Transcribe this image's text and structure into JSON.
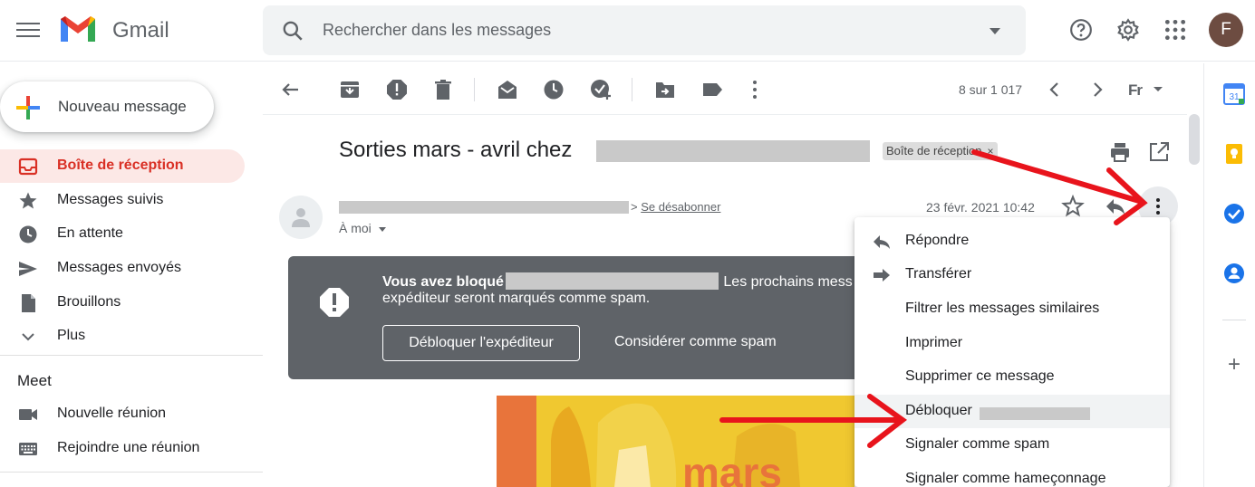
{
  "app": {
    "brand": "Gmail"
  },
  "search": {
    "placeholder": "Rechercher dans les messages"
  },
  "user": {
    "initial": "F",
    "avatar_color": "#6d4c41"
  },
  "compose": {
    "label": "Nouveau message"
  },
  "sidebar": {
    "items": [
      {
        "label": "Boîte de réception",
        "icon": "inbox-icon",
        "active": true
      },
      {
        "label": "Messages suivis",
        "icon": "star-icon"
      },
      {
        "label": "En attente",
        "icon": "clock-icon"
      },
      {
        "label": "Messages envoyés",
        "icon": "send-icon"
      },
      {
        "label": "Brouillons",
        "icon": "draft-icon"
      },
      {
        "label": "Plus",
        "icon": "chevron-down-icon"
      }
    ],
    "meet": {
      "title": "Meet",
      "items": [
        {
          "label": "Nouvelle réunion",
          "icon": "video-icon"
        },
        {
          "label": "Rejoindre une réunion",
          "icon": "keyboard-icon"
        }
      ]
    }
  },
  "toolbar": {
    "pager": "8 sur 1 017",
    "lang": "Fr"
  },
  "message": {
    "subject": "Sorties mars - avril chez",
    "label_chip": "Boîte de réception",
    "label_chip_close": "×",
    "unsubscribe_prefix": ">",
    "unsubscribe": "Se désabonner",
    "to": "À moi",
    "date": "23 févr. 2021 10:42"
  },
  "banner": {
    "blocked_prefix": "Vous avez bloqué",
    "blocked_suffix": "Les prochains mess",
    "line2": "expéditeur seront marqués comme spam.",
    "unblock_button": "Débloquer l'expéditeur",
    "spam_button": "Considérer comme spam"
  },
  "email_image": {
    "text": "mars"
  },
  "menu": {
    "items": [
      {
        "label": "Répondre",
        "icon": "reply-icon"
      },
      {
        "label": "Transférer",
        "icon": "forward-icon"
      },
      {
        "label": "Filtrer les messages similaires"
      },
      {
        "label": "Imprimer"
      },
      {
        "label": "Supprimer ce message"
      },
      {
        "label": "Débloquer",
        "highlighted": true
      },
      {
        "label": "Signaler comme spam"
      },
      {
        "label": "Signaler comme hameçonnage"
      }
    ]
  },
  "right_panel": {
    "calendar_day": "31",
    "add_label": "+"
  },
  "colors": {
    "accent_red": "#d93025",
    "active_bg": "#fce8e6",
    "banner_bg": "#5f6368",
    "arrow_red": "#e8141c"
  }
}
